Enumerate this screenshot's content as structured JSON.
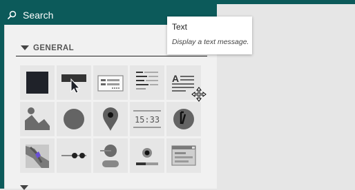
{
  "search": {
    "label": "Search"
  },
  "section": {
    "title": "GENERAL"
  },
  "tiles": [
    {
      "name": "rectangle-tool",
      "icon": "filled-square-icon"
    },
    {
      "name": "button-tool",
      "icon": "button-cursor-icon"
    },
    {
      "name": "form-tool",
      "icon": "form-icon"
    },
    {
      "name": "list-tool",
      "icon": "list-lines-icon"
    },
    {
      "name": "text-tool",
      "icon": "text-lines-icon",
      "letter": "A"
    },
    {
      "name": "image-tool",
      "icon": "image-landscape-icon"
    },
    {
      "name": "circle-tool",
      "icon": "circle-icon"
    },
    {
      "name": "map-pin-tool",
      "icon": "map-pin-icon"
    },
    {
      "name": "digital-clock-tool",
      "icon": "digital-clock-icon",
      "label": "15:33"
    },
    {
      "name": "analog-clock-tool",
      "icon": "analog-clock-icon"
    },
    {
      "name": "map-tool",
      "icon": "map-icon"
    },
    {
      "name": "slider-tool",
      "icon": "slider-icon"
    },
    {
      "name": "toggle-label-tool",
      "icon": "toggle-label-icon"
    },
    {
      "name": "progress-tool",
      "icon": "progress-icon"
    },
    {
      "name": "window-tool",
      "icon": "window-icon"
    }
  ],
  "tooltip": {
    "title": "Text",
    "description": "Display a text message."
  },
  "colors": {
    "header": "#0c5a5a",
    "panel": "#f1f1f1",
    "tile": "#e6e6e6",
    "icon_dark": "#1f2229",
    "icon_mid": "#6b6b6b",
    "accent_purple": "#6a4fd6"
  }
}
